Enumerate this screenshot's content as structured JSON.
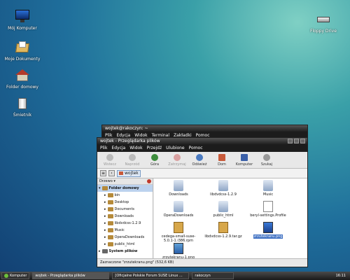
{
  "desktop": {
    "icons": [
      {
        "label": "Mój Komputer",
        "icon": "monitor-icon"
      },
      {
        "label": "Moje Dokumenty",
        "icon": "documents-folder-icon"
      },
      {
        "label": "Folder domowy",
        "icon": "home-icon"
      },
      {
        "label": "Śmietnik",
        "icon": "trash-icon"
      },
      {
        "label": "Floppy Drive",
        "icon": "floppy-drive-icon"
      }
    ]
  },
  "terminal": {
    "title": "wojtek@rakoczyn: ~",
    "menu": [
      "Plik",
      "Edycja",
      "Widok",
      "Terminal",
      "Zakładki",
      "Pomoc"
    ]
  },
  "browser": {
    "title": "wojtek - Przeglądarka plików",
    "menu": [
      "Plik",
      "Edycja",
      "Widok",
      "Przejdź",
      "Ulubione",
      "Pomoc"
    ],
    "toolbar": [
      {
        "label": "Wstecz",
        "enabled": false
      },
      {
        "label": "Naprzód",
        "enabled": false
      },
      {
        "label": "Góra",
        "enabled": true
      },
      {
        "label": "Zatrzymaj",
        "enabled": false
      },
      {
        "label": "Odśwież",
        "enabled": true
      },
      {
        "label": "Dom",
        "enabled": true
      },
      {
        "label": "Komputer",
        "enabled": true
      },
      {
        "label": "Szukaj",
        "enabled": true
      }
    ],
    "path": "wojtek",
    "sidebar_title": "Drzewo",
    "tree": [
      {
        "label": "Folder domowy",
        "root": true
      },
      {
        "label": "bin"
      },
      {
        "label": "Desktop"
      },
      {
        "label": "Documents"
      },
      {
        "label": "Downloads"
      },
      {
        "label": "libdvdcss-1.2.9"
      },
      {
        "label": "Music"
      },
      {
        "label": "OperaDownloads"
      },
      {
        "label": "public_html"
      },
      {
        "label": "System plików",
        "root": true
      }
    ],
    "files": [
      {
        "label": "Downloads",
        "icon": "folder-icon"
      },
      {
        "label": "libdvdcss-1.2.9",
        "icon": "folder-icon"
      },
      {
        "label": "Music",
        "icon": "folder-icon"
      },
      {
        "label": "OperaDownloads",
        "icon": "folder-icon"
      },
      {
        "label": "public_html",
        "icon": "folder-icon"
      },
      {
        "label": "beryl-settings.Profile",
        "icon": "text-file-icon"
      },
      {
        "label": "cedega-small-suse-5.0.1-1.i386.rpm",
        "icon": "package-icon"
      },
      {
        "label": "libdvdcss-1.2.9.tar.gz",
        "icon": "archive-icon"
      },
      {
        "label": "zrzutekranu.png",
        "icon": "image-icon",
        "selected": true
      },
      {
        "label": "zrzutekranu-1.png",
        "icon": "image-icon"
      }
    ],
    "status": "Zaznaczone \"zrzutekranu.png\" (532,6 KB)"
  },
  "panel": {
    "start": "Komputer",
    "tasks": [
      {
        "label": "wojtek - Przeglądarka plików",
        "active": true
      },
      {
        "label": "[Oficjalne Polskie Forum SUSE Linux ..."
      },
      {
        "label": "rakoczyn"
      }
    ],
    "clock": "16:11"
  }
}
